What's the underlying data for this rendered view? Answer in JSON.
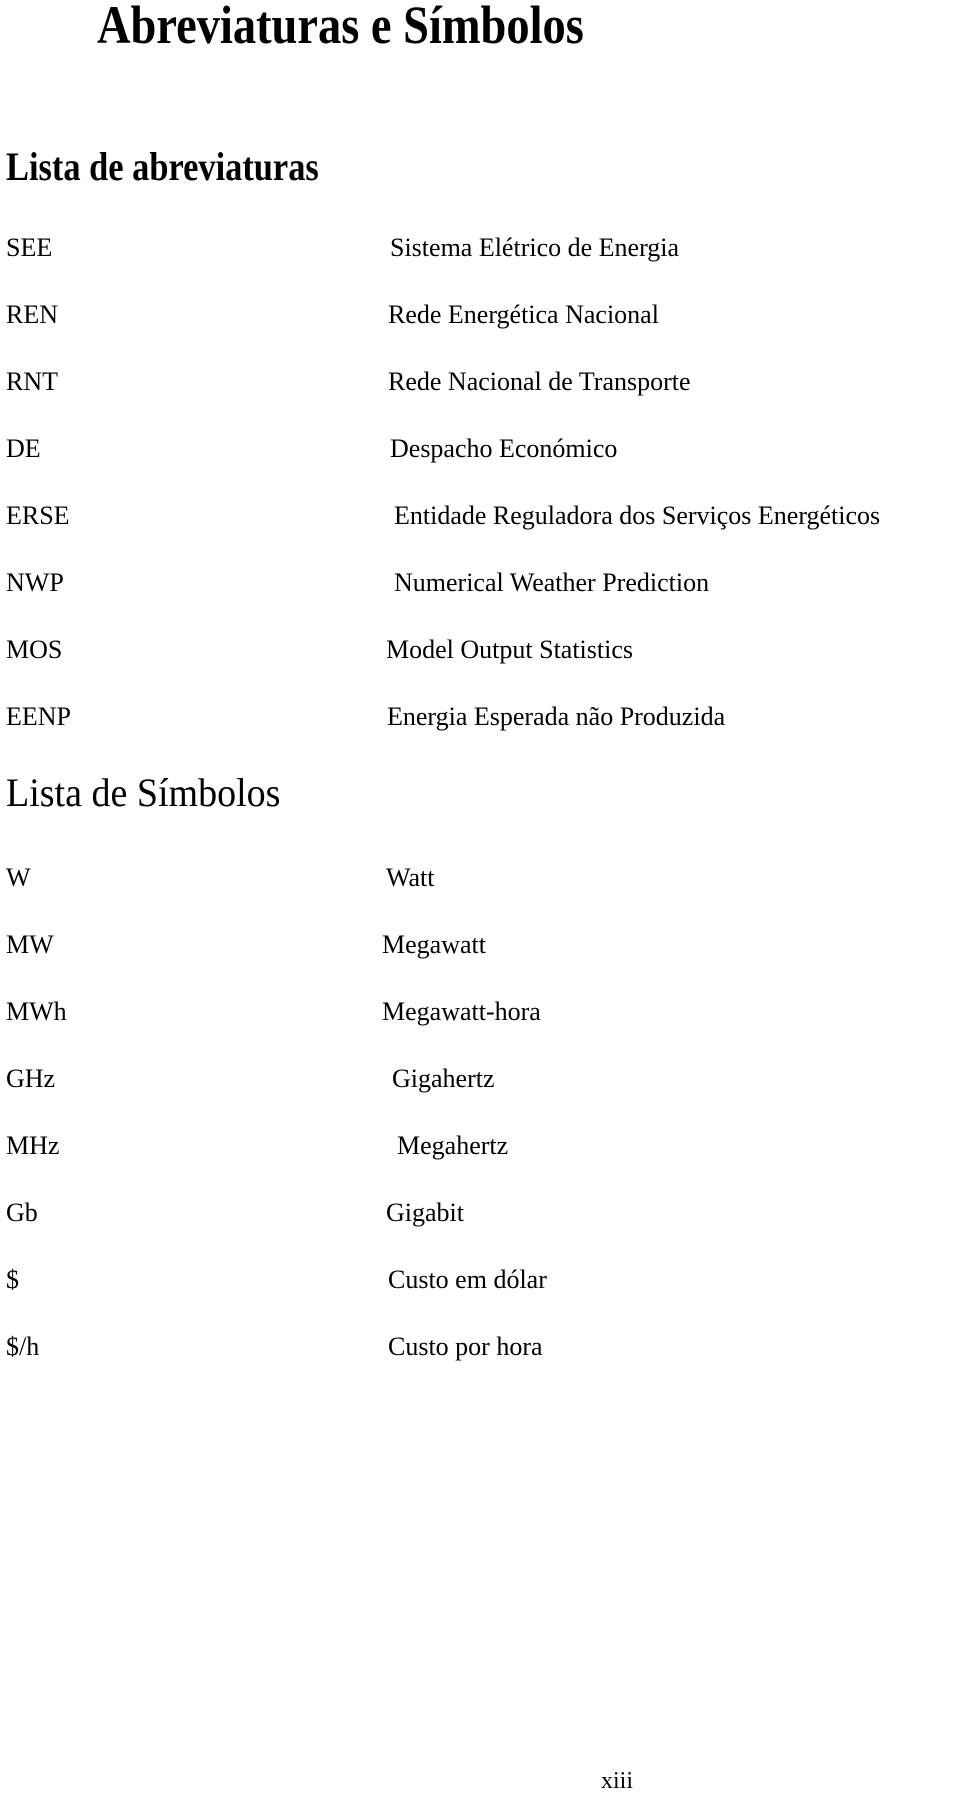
{
  "document": {
    "title": "Abreviaturas e Símbolos",
    "page_number": "xiii"
  },
  "abbreviations": {
    "heading": "Lista de abreviaturas",
    "items": [
      {
        "abbr": "SEE",
        "desc": "Sistema Elétrico de Energia"
      },
      {
        "abbr": "REN",
        "desc": "Rede Energética Nacional"
      },
      {
        "abbr": "RNT",
        "desc": "Rede Nacional de Transporte"
      },
      {
        "abbr": "DE",
        "desc": "Despacho Económico"
      },
      {
        "abbr": "ERSE",
        "desc": "Entidade Reguladora dos Serviços Energéticos"
      },
      {
        "abbr": "NWP",
        "desc": "Numerical Weather Prediction"
      },
      {
        "abbr": "MOS",
        "desc": "Model Output Statistics"
      },
      {
        "abbr": "EENP",
        "desc": "Energia Esperada não Produzida"
      }
    ]
  },
  "symbols": {
    "heading": "Lista de Símbolos",
    "items": [
      {
        "abbr": "W",
        "desc": "Watt"
      },
      {
        "abbr": "MW",
        "desc": "Megawatt"
      },
      {
        "abbr": "MWh",
        "desc": "Megawatt-hora"
      },
      {
        "abbr": "GHz",
        "desc": "Gigahertz"
      },
      {
        "abbr": "MHz",
        "desc": "Megahertz"
      },
      {
        "abbr": "Gb",
        "desc": "Gigabit"
      },
      {
        "abbr": "$",
        "desc": "Custo em dólar"
      },
      {
        "abbr": "$/h",
        "desc": "Custo por hora"
      }
    ]
  }
}
